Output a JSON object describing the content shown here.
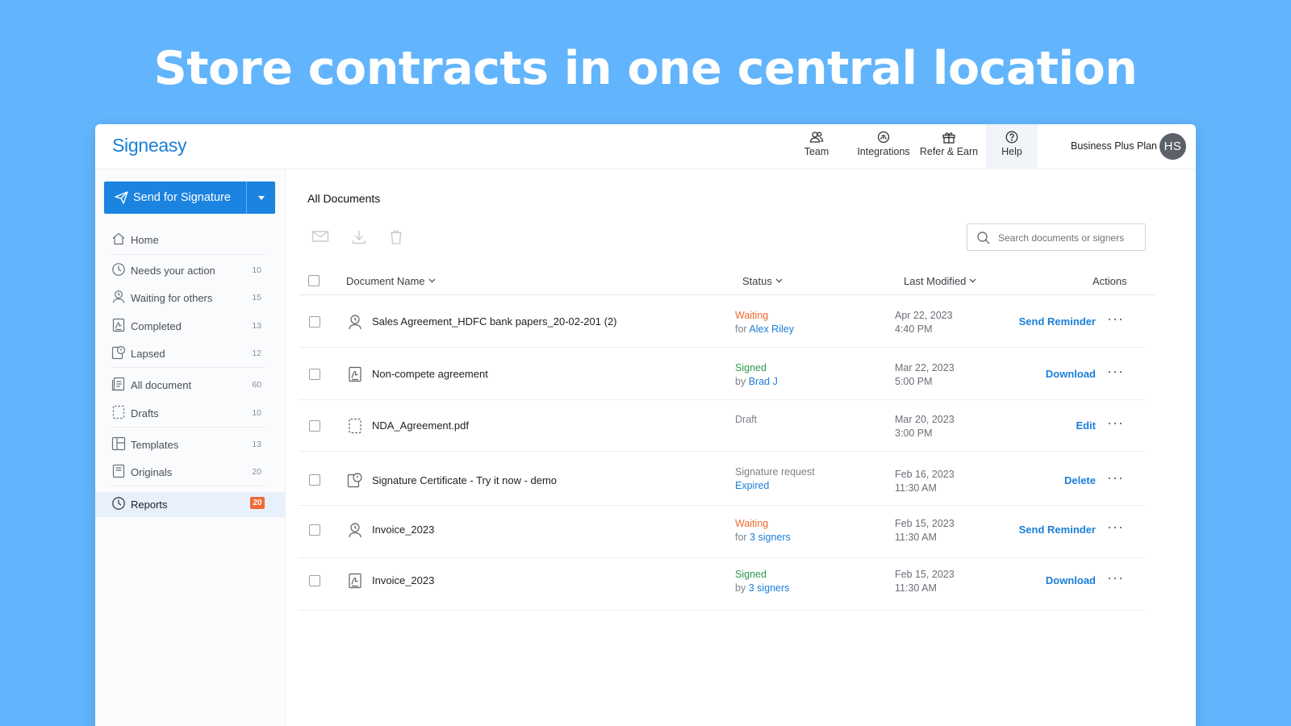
{
  "hero": {
    "title": "Store contracts in one central location"
  },
  "app": {
    "logo": "Signeasy",
    "nav": [
      {
        "label": "Team",
        "icon": "team-icon"
      },
      {
        "label": "Integrations",
        "icon": "integrations-icon"
      },
      {
        "label": "Refer & Earn",
        "icon": "gift-icon"
      },
      {
        "label": "Help",
        "icon": "help-icon"
      }
    ],
    "plan": "Business Plus Plan",
    "avatar_initials": "HS"
  },
  "sidebar": {
    "send_button": "Send for Signature",
    "items": [
      {
        "label": "Home",
        "count": ""
      },
      {
        "label": "Needs your action",
        "count": "10"
      },
      {
        "label": "Waiting for others",
        "count": "15"
      },
      {
        "label": "Completed",
        "count": "13"
      },
      {
        "label": "Lapsed",
        "count": "12"
      },
      {
        "label": "All document",
        "count": "60"
      },
      {
        "label": "Drafts",
        "count": "10"
      },
      {
        "label": "Templates",
        "count": "13"
      },
      {
        "label": "Originals",
        "count": "20"
      },
      {
        "label": "Reports",
        "count": "20"
      }
    ],
    "active_color": "#e8f0fb",
    "badge_color": "#f06a3a"
  },
  "main": {
    "title": "All Documents",
    "search_placeholder": "Search documents or signers",
    "columns": {
      "name": "Document Name",
      "status": "Status",
      "modified": "Last Modified",
      "actions": "Actions"
    },
    "rows": [
      {
        "name": "Sales Agreement_HDFC bank papers_20-02-201 (2)",
        "status": "Waiting",
        "status_pre": "for",
        "status_who": "Alex Riley",
        "date": "Apr 22, 2023",
        "time": "4:40 PM",
        "action": "Send Reminder",
        "more": "···"
      },
      {
        "name": "Non-compete agreement",
        "status": "Signed",
        "status_pre": "by",
        "status_who": "Brad J",
        "date": "Mar 22, 2023",
        "time": "5:00 PM",
        "action": "Download",
        "more": "···"
      },
      {
        "name": "NDA_Agreement.pdf",
        "status": "Draft",
        "status_pre": "",
        "status_who": "",
        "date": "Mar 20, 2023",
        "time": "3:00 PM",
        "action": "Edit",
        "more": "···"
      },
      {
        "name": "Signature Certificate - Try it now - demo",
        "status": "Signature request",
        "status_pre": "",
        "status_who": "Expired",
        "date": "Feb 16, 2023",
        "time": "11:30 AM",
        "action": "Delete",
        "more": "···"
      },
      {
        "name": "Invoice_2023",
        "status": "Waiting",
        "status_pre": "for",
        "status_who": "3 signers",
        "date": "Feb 15, 2023",
        "time": "11:30 AM",
        "action": "Send Reminder",
        "more": "···"
      },
      {
        "name": "Invoice_2023",
        "status": "Signed",
        "status_pre": "by",
        "status_who": "3 signers",
        "date": "Feb 15, 2023",
        "time": "11:30 AM",
        "action": "Download",
        "more": "···"
      }
    ]
  },
  "colors": {
    "background": "#62b5fc",
    "brand": "#1b83e0",
    "waiting": "#ee6a2f",
    "signed": "#2a9c4a",
    "link": "#1b7ed8"
  }
}
